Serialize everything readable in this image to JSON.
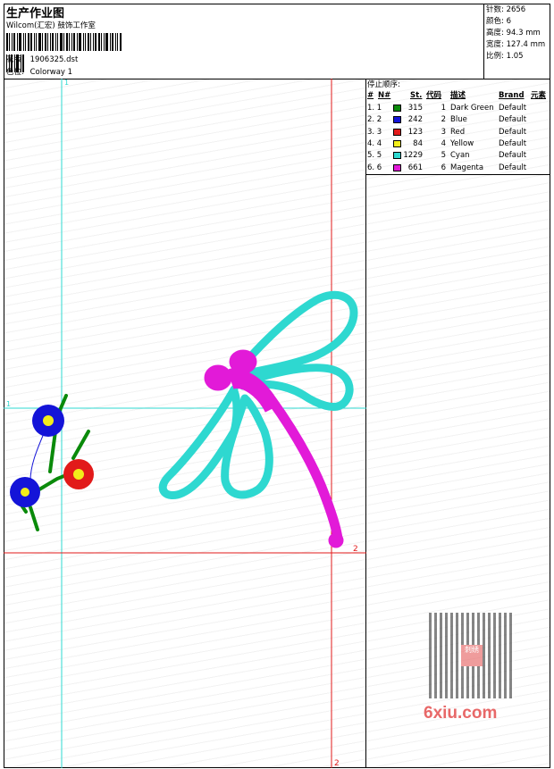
{
  "header": {
    "title": "生产作业图",
    "studio": "Wilcom(汇宏) 鼓饰工作室",
    "design_label": "花版:",
    "design_value": "1906325.dst",
    "colorway_label": "色位:",
    "colorway_value": "Colorway 1"
  },
  "stats": [
    {
      "label": "针数:",
      "value": "2656"
    },
    {
      "label": "颜色:",
      "value": "6"
    },
    {
      "label": "高度:",
      "value": "94.3 mm"
    },
    {
      "label": "宽度:",
      "value": "127.4 mm"
    },
    {
      "label": "比例:",
      "value": "1.05"
    }
  ],
  "stop_sequence": {
    "title": "停止顺序:",
    "columns": [
      "#",
      "N#",
      "St.",
      "代码",
      "描述",
      "Brand",
      "元素"
    ],
    "rows": [
      {
        "idx": "1. 1",
        "color": "#0a8a0a",
        "stitches": "315",
        "code": "1",
        "desc": "Dark Green",
        "brand": "Default"
      },
      {
        "idx": "2. 2",
        "color": "#1414d8",
        "stitches": "242",
        "code": "2",
        "desc": "Blue",
        "brand": "Default"
      },
      {
        "idx": "3. 3",
        "color": "#e21a1a",
        "stitches": "123",
        "code": "3",
        "desc": "Red",
        "brand": "Default"
      },
      {
        "idx": "4. 4",
        "color": "#f2ee1a",
        "stitches": "84",
        "code": "4",
        "desc": "Yellow",
        "brand": "Default"
      },
      {
        "idx": "5. 5",
        "color": "#2ed8d0",
        "stitches": "1229",
        "code": "5",
        "desc": "Cyan",
        "brand": "Default"
      },
      {
        "idx": "6. 6",
        "color": "#e21ad8",
        "stitches": "661",
        "code": "6",
        "desc": "Magenta",
        "brand": "Default"
      }
    ]
  },
  "guides": {
    "cyan_label": "1",
    "red_label": "2"
  },
  "watermark": {
    "text": "6xiu.com",
    "stamp": "刺绣"
  }
}
